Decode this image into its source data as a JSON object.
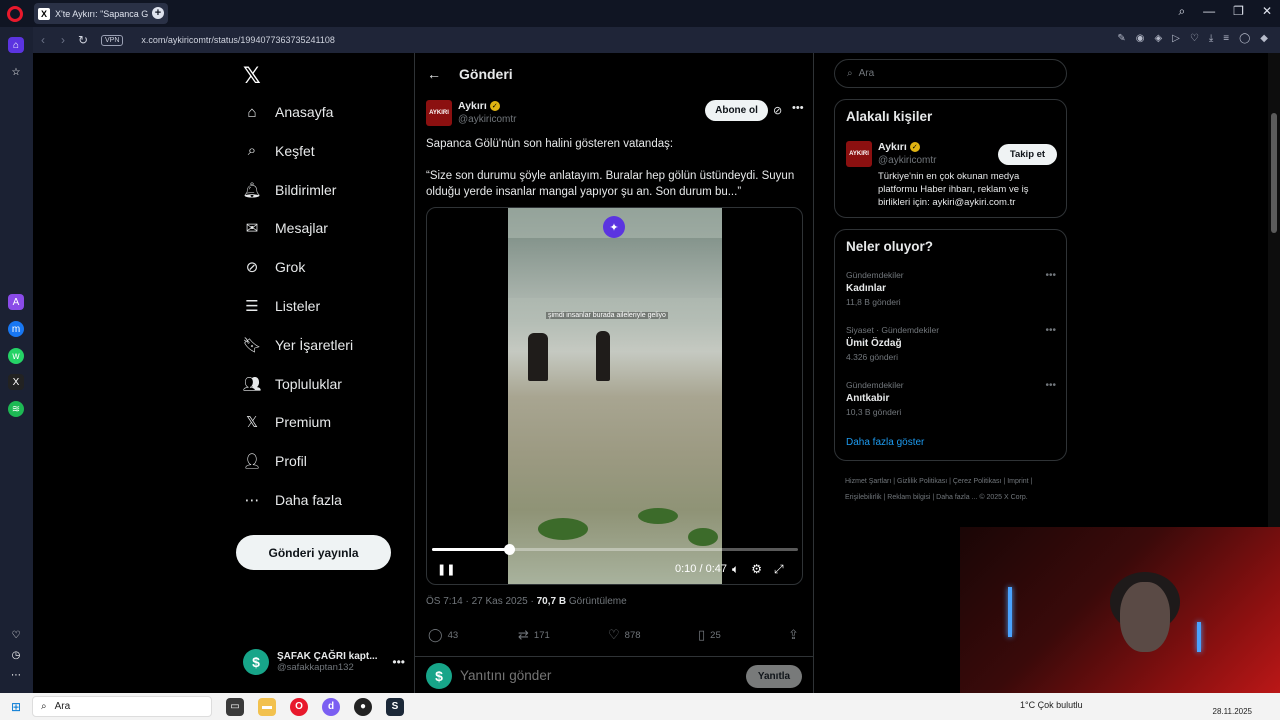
{
  "browser": {
    "tab_title": "X'te Aykırı: \"Sapanca G",
    "url": "x.com/aykiricomtr/status/1994077363735241108",
    "vpn_label": "VPN"
  },
  "left_nav": {
    "items": [
      {
        "label": "Anasayfa",
        "icon": "home-icon"
      },
      {
        "label": "Keşfet",
        "icon": "search-icon"
      },
      {
        "label": "Bildirimler",
        "icon": "bell-icon"
      },
      {
        "label": "Mesajlar",
        "icon": "mail-icon"
      },
      {
        "label": "Grok",
        "icon": "grok-icon"
      },
      {
        "label": "Listeler",
        "icon": "list-icon"
      },
      {
        "label": "Yer İşaretleri",
        "icon": "bookmark-icon"
      },
      {
        "label": "Topluluklar",
        "icon": "people-icon"
      },
      {
        "label": "Premium",
        "icon": "x-icon"
      },
      {
        "label": "Profil",
        "icon": "person-icon"
      },
      {
        "label": "Daha fazla",
        "icon": "more-circle-icon"
      }
    ],
    "post_button": "Gönderi yayınla",
    "account": {
      "name": "ŞAFAK ÇAĞRI kapt...",
      "handle": "@safakkaptan132",
      "avatar_letter": "$"
    }
  },
  "post": {
    "header_title": "Gönderi",
    "author": {
      "name": "Aykırı",
      "handle": "@aykiricomtr",
      "avatar_text": "AYKIRI"
    },
    "follow_label": "Abone ol",
    "text_1": "Sapanca Gölü'nün son halini gösteren vatandaş:",
    "text_2": "“Size son durumu şöyle anlatayım. Buralar hep gölün üstündeydi. Suyun olduğu yerde insanlar mangal yapıyor şu an. Son durum bu...”",
    "video": {
      "caption": "şimdi insanlar burada aileleriyle geliyo",
      "time": "0:10 / 0:47",
      "progress": 0.21
    },
    "meta": {
      "time": "ÖS 7:14 · 27 Kas 2025 · ",
      "views": "70,7 B",
      "views_label": " Görüntüleme"
    },
    "actions": {
      "replies": "43",
      "reposts": "171",
      "likes": "878",
      "bookmarks": "25"
    },
    "reply_placeholder": "Yanıtını gönder",
    "reply_button": "Yanıtla"
  },
  "right": {
    "search_placeholder": "Ara",
    "related_title": "Alakalı kişiler",
    "related": {
      "name": "Aykırı",
      "handle": "@aykiricomtr",
      "follow": "Takip et",
      "bio": "Türkiye'nin en çok okunan medya platformu Haber ihbarı, reklam ve iş birlikleri için: aykiri@aykiri.com.tr"
    },
    "trends_title": "Neler oluyor?",
    "trends": [
      {
        "category": "Gündemdekiler",
        "name": "Kadınlar",
        "count": "11,8 B gönderi"
      },
      {
        "category": "Siyaset · Gündemdekiler",
        "name": "Ümit Özdağ",
        "count": "4.326 gönderi"
      },
      {
        "category": "Gündemdekiler",
        "name": "Anıtkabir",
        "count": "10,3 B gönderi"
      }
    ],
    "show_more": "Daha fazla göster",
    "footer": "Hizmet Şartları  |  Gizlilik Politikası  |  Çerez Politikası  |  Imprint  |  Erişilebilirlik  |  Reklam bilgisi  |  Daha fazla ...  © 2025 X Corp."
  },
  "taskbar": {
    "search_label": "Ara",
    "tray_text": "1°C  Çok bulutlu",
    "date": "28.11.2025"
  }
}
